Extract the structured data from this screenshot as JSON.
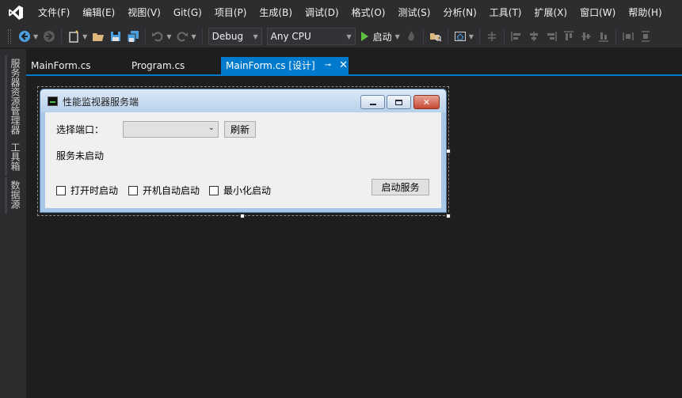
{
  "menubar": {
    "items": [
      "文件(F)",
      "编辑(E)",
      "视图(V)",
      "Git(G)",
      "项目(P)",
      "生成(B)",
      "调试(D)",
      "格式(O)",
      "测试(S)",
      "分析(N)",
      "工具(T)",
      "扩展(X)",
      "窗口(W)",
      "帮助(H)"
    ]
  },
  "toolbar": {
    "config": "Debug",
    "platform": "Any CPU",
    "start_label": "启动"
  },
  "side_tabs": [
    "服务器资源管理器",
    "工具箱",
    "数据源"
  ],
  "doc_tabs": [
    {
      "label": "MainForm.cs"
    },
    {
      "label": "Program.cs"
    },
    {
      "label": "MainForm.cs [设计]"
    }
  ],
  "form": {
    "title": "性能监视器服务端",
    "port_label": "选择端口：",
    "port_value": "",
    "refresh_label": "刷新",
    "status_text": "服务未启动",
    "checkboxes": [
      {
        "label": "打开时启动",
        "checked": false
      },
      {
        "label": "开机自动启动",
        "checked": false
      },
      {
        "label": "最小化启动",
        "checked": false
      }
    ],
    "start_service_label": "启动服务"
  },
  "colors": {
    "accent": "#007acc",
    "chrome": "#2d2d30",
    "editor_bg": "#1e1e1e"
  }
}
